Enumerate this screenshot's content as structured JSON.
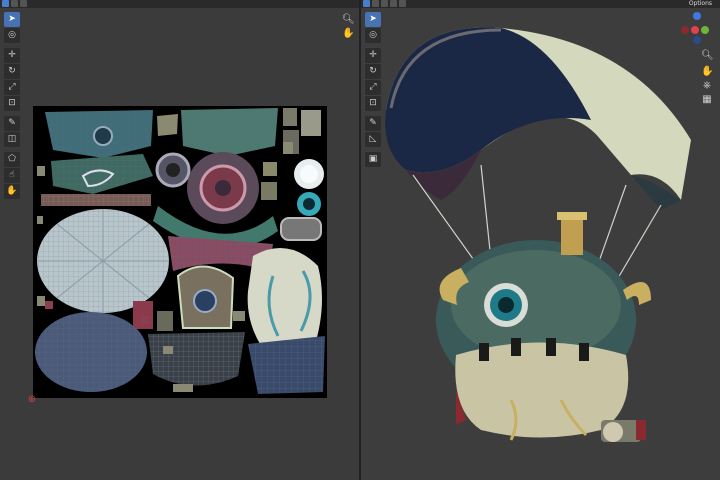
{
  "viewport": {
    "options_label": "Options"
  },
  "colors": {
    "accent": "#4772b3",
    "background": "#3d3d3d",
    "uv_background": "#000000",
    "gizmo_x": "#e0424d",
    "gizmo_y": "#6fb538",
    "gizmo_z": "#3f7ae0"
  },
  "icons": {
    "uv_tools": [
      "select-icon",
      "cursor-icon",
      "move-icon",
      "rotate-icon",
      "scale-icon",
      "transform-icon",
      "annotate-icon",
      "rip-icon",
      "grab-icon",
      "relax-icon",
      "pinch-icon"
    ],
    "viewport_tools": [
      "select-icon",
      "cursor-icon",
      "move-icon",
      "rotate-icon",
      "scale-icon",
      "transform-icon",
      "annotate-icon",
      "measure-icon",
      "add-cube-icon"
    ]
  }
}
